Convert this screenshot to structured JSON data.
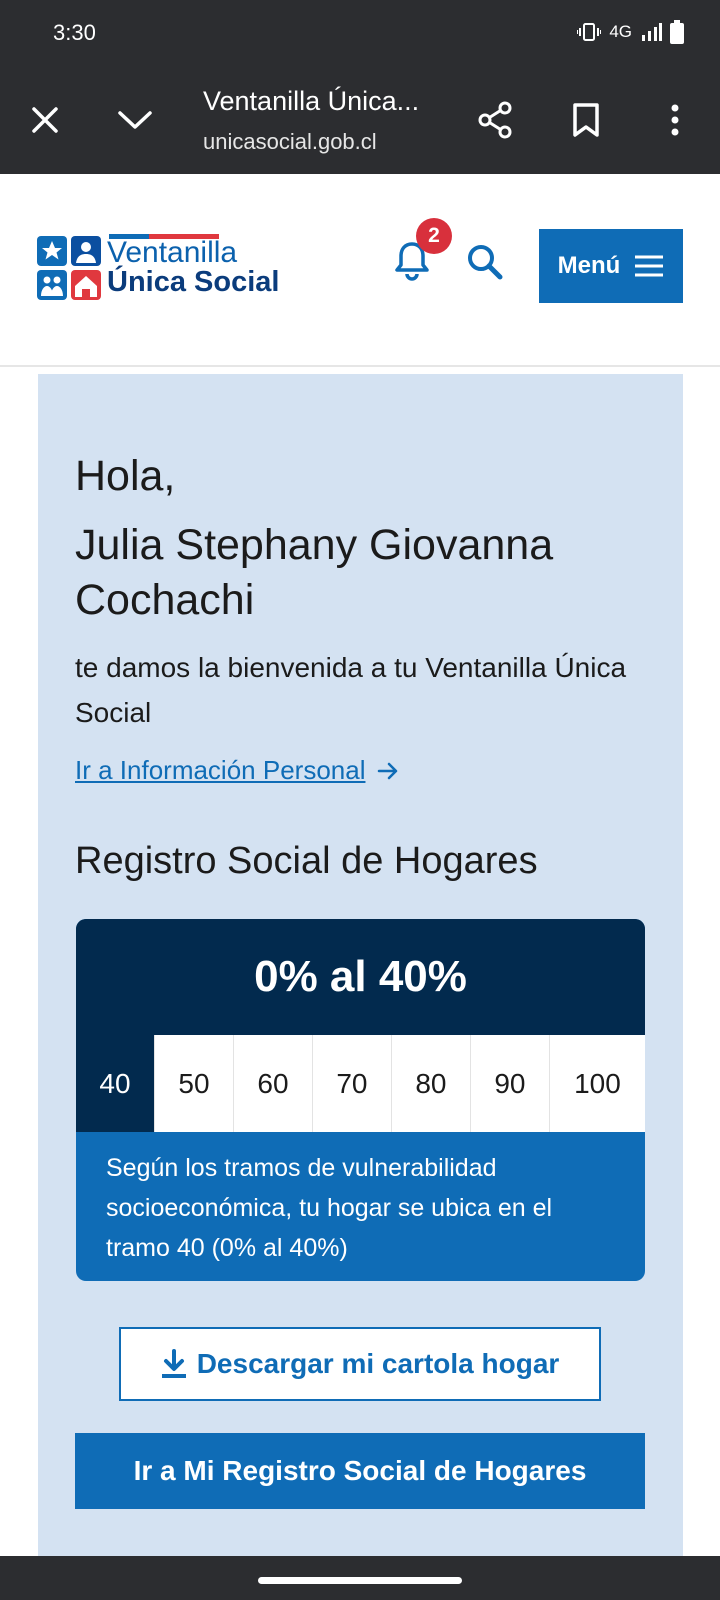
{
  "status_bar": {
    "time": "3:30",
    "network": "4G"
  },
  "browser": {
    "title": "Ventanilla Única...",
    "url": "unicasocial.gob.cl",
    "icons": [
      "close-icon",
      "chevron-down-icon",
      "share-icon",
      "bookmark-icon",
      "more-vert-icon"
    ]
  },
  "header": {
    "logo_line1": "Ventanilla",
    "logo_line2": "Única Social",
    "notification_count": "2",
    "menu_label": "Menú"
  },
  "greeting": {
    "hello": "Hola,",
    "name": "Julia Stephany Giovanna Cochachi",
    "welcome": "te damos la bienvenida a tu Ventanilla Única Social",
    "personal_info_link": "Ir a Información Personal"
  },
  "rsh": {
    "title": "Registro Social de Hogares",
    "range_label": "0% al 40%",
    "scale": [
      "40",
      "50",
      "60",
      "70",
      "80",
      "90",
      "100"
    ],
    "active_tramo": "40",
    "description": "Según los tramos de vulnerabilidad socioeconómica, tu hogar se ubica en el tramo 40 (0% al 40%)",
    "download_label": "Descargar mi cartola hogar",
    "go_label": "Ir a Mi Registro Social de Hogares"
  },
  "colors": {
    "primary": "#0f6cb6",
    "dark": "#022a4e",
    "panel": "#d4e2f2",
    "badge": "#d8303c"
  }
}
